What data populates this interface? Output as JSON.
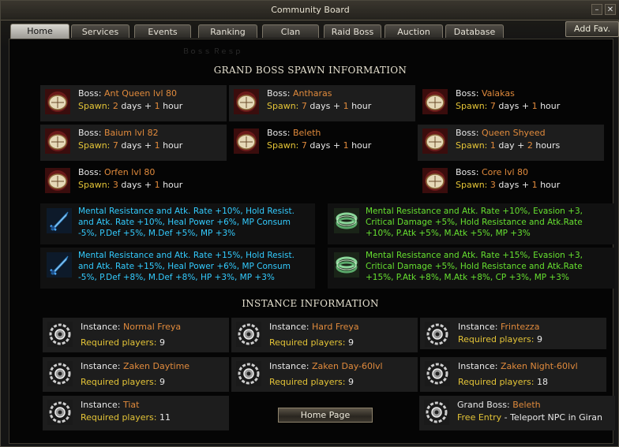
{
  "window": {
    "title": "Community Board"
  },
  "tabs": [
    "Home",
    "Services",
    "Events",
    "Ranking",
    "Clan",
    "Raid Boss",
    "Auction",
    "Database"
  ],
  "add_fav": "Add Fav.",
  "faded_text": "Ｂｏｓｓ Ｒｅｓｐ",
  "grand_boss": {
    "title": "GRAND BOSS SPAWN INFORMATION",
    "boss_label": "Boss:",
    "spawn_label": "Spawn:",
    "days_word": "days",
    "day_word": "day",
    "hour_word": "hour",
    "hours_word": "hours",
    "plus": "+",
    "bosses": [
      {
        "name": "Ant Queen lvl 80",
        "days": "2",
        "days_word": "days",
        "hours": "1",
        "hours_word": "hour"
      },
      {
        "name": "Antharas",
        "days": "7",
        "days_word": "days",
        "hours": "1",
        "hours_word": "hour"
      },
      {
        "name": "Valakas",
        "days": "7",
        "days_word": "days",
        "hours": "1",
        "hours_word": "hour"
      },
      {
        "name": "Baium lvl 82",
        "days": "7",
        "days_word": "days",
        "hours": "1",
        "hours_word": "hour"
      },
      {
        "name": "Beleth",
        "days": "7",
        "days_word": "days",
        "hours": "1",
        "hours_word": "hour"
      },
      {
        "name": "Queen Shyeed",
        "days": "1",
        "days_word": "day",
        "hours": "2",
        "hours_word": "hours"
      },
      {
        "name": "Orfen lvl 80",
        "days": "3",
        "days_word": "days",
        "hours": "1",
        "hours_word": "hour"
      },
      {
        "name": "Core lvl 80",
        "days": "3",
        "days_word": "days",
        "hours": "1",
        "hours_word": "hour"
      }
    ],
    "buffs": [
      {
        "text": "Mental Resistance and Atk. Rate +10%, Hold Resist. and Atk. Rate +10%, Heal Power +6%, MP Consum -5%, P.Def +5%, M.Def +5%, MP +3%"
      },
      {
        "text": "Mental Resistance and Atk. Rate +10%, Evasion +3, Critical Damage +5%, Hold Resistance and Atk.Rate +10%, P.Atk +5%, M.Atk +5%, MP +3%"
      },
      {
        "text": "Mental Resistance and Atk. Rate +15%, Hold Resist. and Atk. Rate +15%, Heal Power +6%, MP Consum -5%, P.Def +8%, M.Def +8%, HP +3%, MP +3%"
      },
      {
        "text": "Mental Resistance and Atk. Rate +15%, Evasion +3, Critical Damage +5%, Hold Resistance and Atk.Rate +15%, P.Atk +8%, M.Atk +8%, CP +3%, MP +3%"
      }
    ]
  },
  "instances": {
    "title": "INSTANCE INFORMATION",
    "instance_label": "Instance:",
    "players_label": "Required players:",
    "items": [
      {
        "name": "Normal Freya",
        "players": "9"
      },
      {
        "name": "Hard Freya",
        "players": "9"
      },
      {
        "name": "Frintezza",
        "players": "9"
      },
      {
        "name": "Zaken Daytime",
        "players": "9"
      },
      {
        "name": "Zaken Day-60lvl",
        "players": "9"
      },
      {
        "name": "Zaken Night-60lvl",
        "players": "18"
      },
      {
        "name": "Tiat",
        "players": "11"
      }
    ],
    "grand_boss_label": "Grand Boss:",
    "grand_boss_name": "Beleth",
    "free_entry": "Free Entry",
    "free_entry_rest": " - Teleport NPC in Giran"
  },
  "home_button": "Home Page",
  "colors": {
    "orange": "#e08a3c",
    "yellow": "#e4c437",
    "cyan": "#33ccff",
    "green": "#66e030"
  },
  "icons": {
    "boss": "clock-compass-icon",
    "instance": "gear-portal-icon",
    "buff1": "blue-sword-icon",
    "buff2": "jade-bracelet-icon"
  }
}
